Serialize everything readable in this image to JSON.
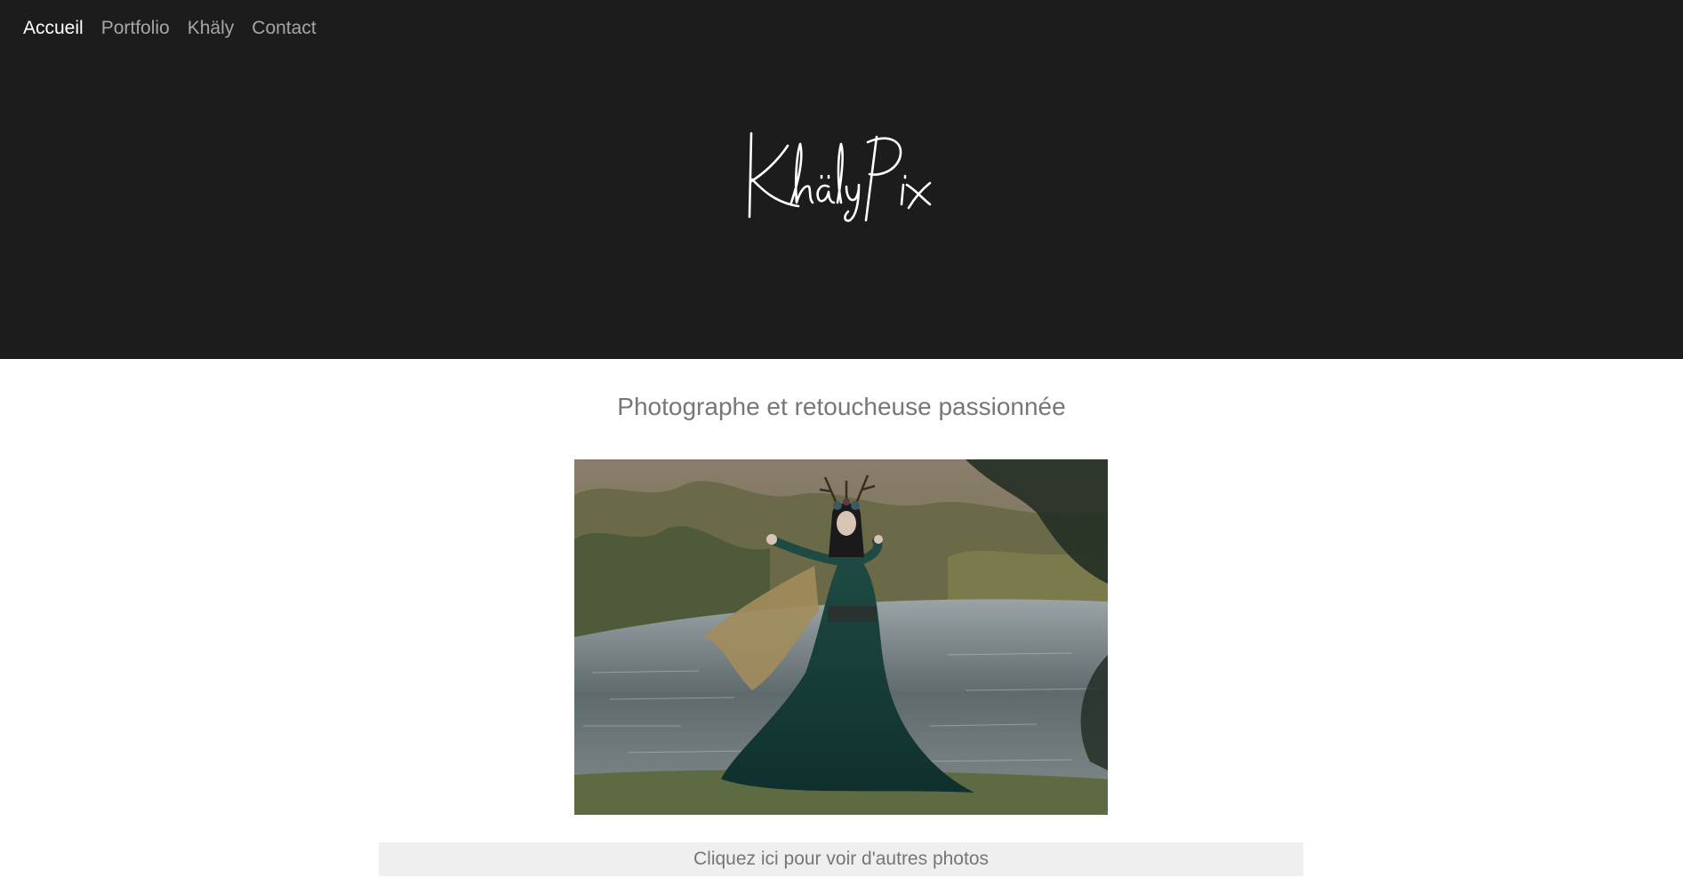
{
  "nav": {
    "items": [
      {
        "label": "Accueil",
        "active": true
      },
      {
        "label": "Portfolio",
        "active": false
      },
      {
        "label": "Khäly",
        "active": false
      },
      {
        "label": "Contact",
        "active": false
      }
    ]
  },
  "header": {
    "logo_text": "Khäly Pix",
    "background": "#1c1c1c"
  },
  "main": {
    "tagline": "Photographe et retoucheuse passionnée",
    "more_button": "Cliquez ici pour voir d'autres photos"
  },
  "colors": {
    "nav_active": "#ffffff",
    "nav_inactive": "#a6a6a6",
    "tagline": "#777777",
    "button_bg": "#efefef"
  }
}
